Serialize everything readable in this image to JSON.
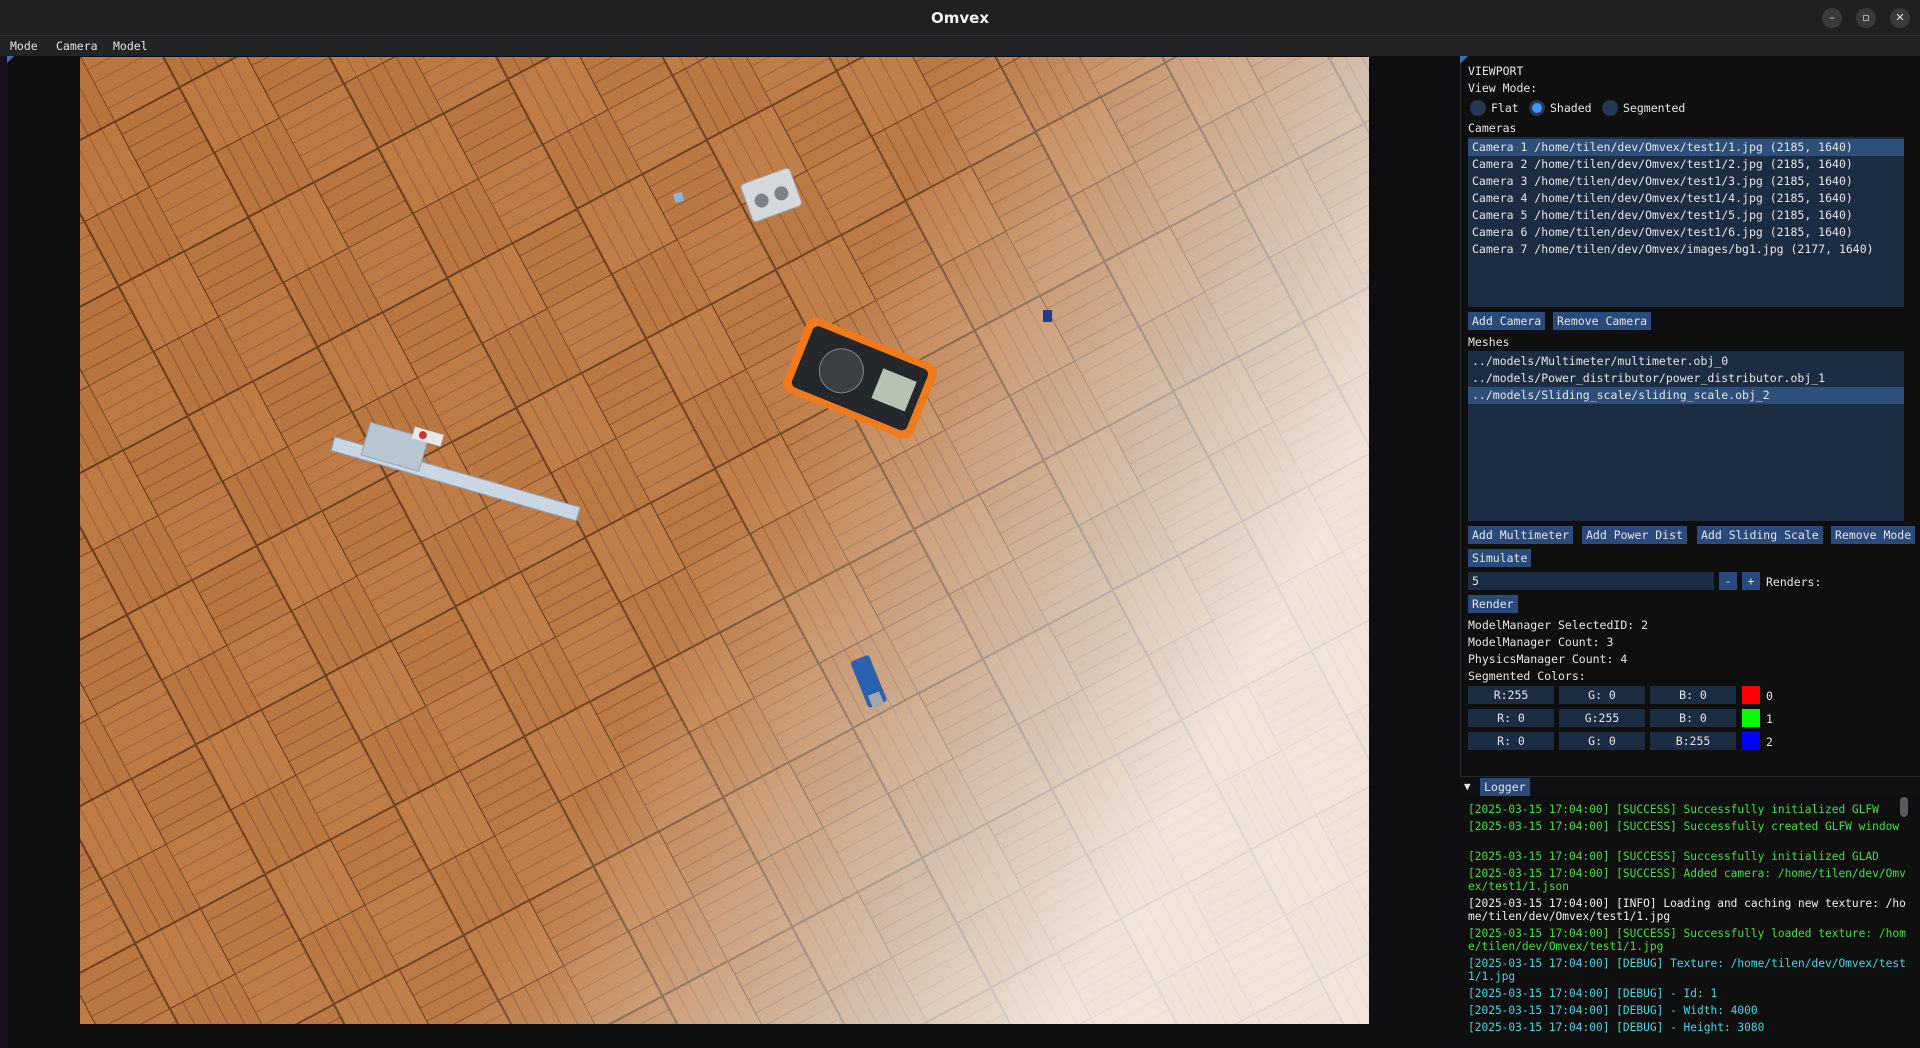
{
  "window": {
    "title": "Omvex"
  },
  "menu": {
    "items": [
      "Mode",
      "Camera",
      "Model"
    ]
  },
  "viewport": {
    "header": "VIEWPORT",
    "view_mode_label": "View Mode:",
    "modes": [
      "Flat",
      "Shaded",
      "Segmented"
    ],
    "selected_mode": "Shaded",
    "cameras_label": "Cameras",
    "cameras": [
      "Camera 1 /home/tilen/dev/Omvex/test1/1.jpg (2185, 1640)",
      "Camera 2 /home/tilen/dev/Omvex/test1/2.jpg (2185, 1640)",
      "Camera 3 /home/tilen/dev/Omvex/test1/3.jpg (2185, 1640)",
      "Camera 4 /home/tilen/dev/Omvex/test1/4.jpg (2185, 1640)",
      "Camera 5 /home/tilen/dev/Omvex/test1/5.jpg (2185, 1640)",
      "Camera 6 /home/tilen/dev/Omvex/test1/6.jpg (2185, 1640)",
      "Camera 7 /home/tilen/dev/Omvex/images/bg1.jpg (2177, 1640)"
    ],
    "add_camera": "Add Camera",
    "remove_camera": "Remove Camera",
    "meshes_label": "Meshes",
    "meshes": [
      "../models/Multimeter/multimeter.obj_0",
      "../models/Power_distributor/power_distributor.obj_1",
      "../models/Sliding_scale/sliding_scale.obj_2"
    ],
    "add_multimeter": "Add Multimeter",
    "add_power_dist": "Add Power Dist",
    "add_sliding_scale": "Add Sliding Scale",
    "remove_model": "Remove Mode",
    "simulate": "Simulate",
    "renders_value": "5",
    "minus": "-",
    "plus": "+",
    "renders_label": "Renders:",
    "render": "Render",
    "selected_id": "ModelManager SelectedID: 2",
    "model_count": "ModelManager Count: 3",
    "physics_count": "PhysicsManager Count: 4",
    "segmented_colors_label": "Segmented Colors:",
    "segmented_colors": [
      {
        "r": "R:255",
        "g": "G:  0",
        "b": "B:  0",
        "hex": "#ff0000",
        "index": "0"
      },
      {
        "r": "R:  0",
        "g": "G:255",
        "b": "B:  0",
        "hex": "#00ff00",
        "index": "1"
      },
      {
        "r": "R:  0",
        "g": "G:  0",
        "b": "B:255",
        "hex": "#0000ff",
        "index": "2"
      }
    ]
  },
  "logger": {
    "tab": "Logger",
    "lines": [
      {
        "text": "[2025-03-15 17:04:00] [SUCCESS] Successfully initialized GLFW",
        "color": "#3fe03f"
      },
      {
        "text": "[2025-03-15 17:04:00] [SUCCESS] Successfully created GLFW window",
        "color": "#3fe03f"
      },
      {
        "text": "[2025-03-15 17:04:00] [SUCCESS] Successfully initialized GLAD",
        "color": "#3fe03f"
      },
      {
        "text": "[2025-03-15 17:04:00] [SUCCESS] Added camera: /home/tilen/dev/Omvex/test1/1.json",
        "color": "#3fe03f"
      },
      {
        "text": "[2025-03-15 17:04:00] [INFO] Loading and caching new texture: /home/tilen/dev/Omvex/test1/1.jpg",
        "color": "#f0f0f0"
      },
      {
        "text": "[2025-03-15 17:04:00] [SUCCESS] Successfully loaded texture: /home/tilen/dev/Omvex/test1/1.jpg",
        "color": "#3fe03f"
      },
      {
        "text": "[2025-03-15 17:04:00] [DEBUG] Texture: /home/tilen/dev/Omvex/test1/1.jpg",
        "color": "#3fd9e6"
      },
      {
        "text": "[2025-03-15 17:04:00] [DEBUG] - Id: 1",
        "color": "#3fd9e6"
      },
      {
        "text": "[2025-03-15 17:04:00] [DEBUG] - Width: 4000",
        "color": "#3fd9e6"
      },
      {
        "text": "[2025-03-15 17:04:00] [DEBUG] - Height: 3080",
        "color": "#3fd9e6"
      }
    ]
  }
}
